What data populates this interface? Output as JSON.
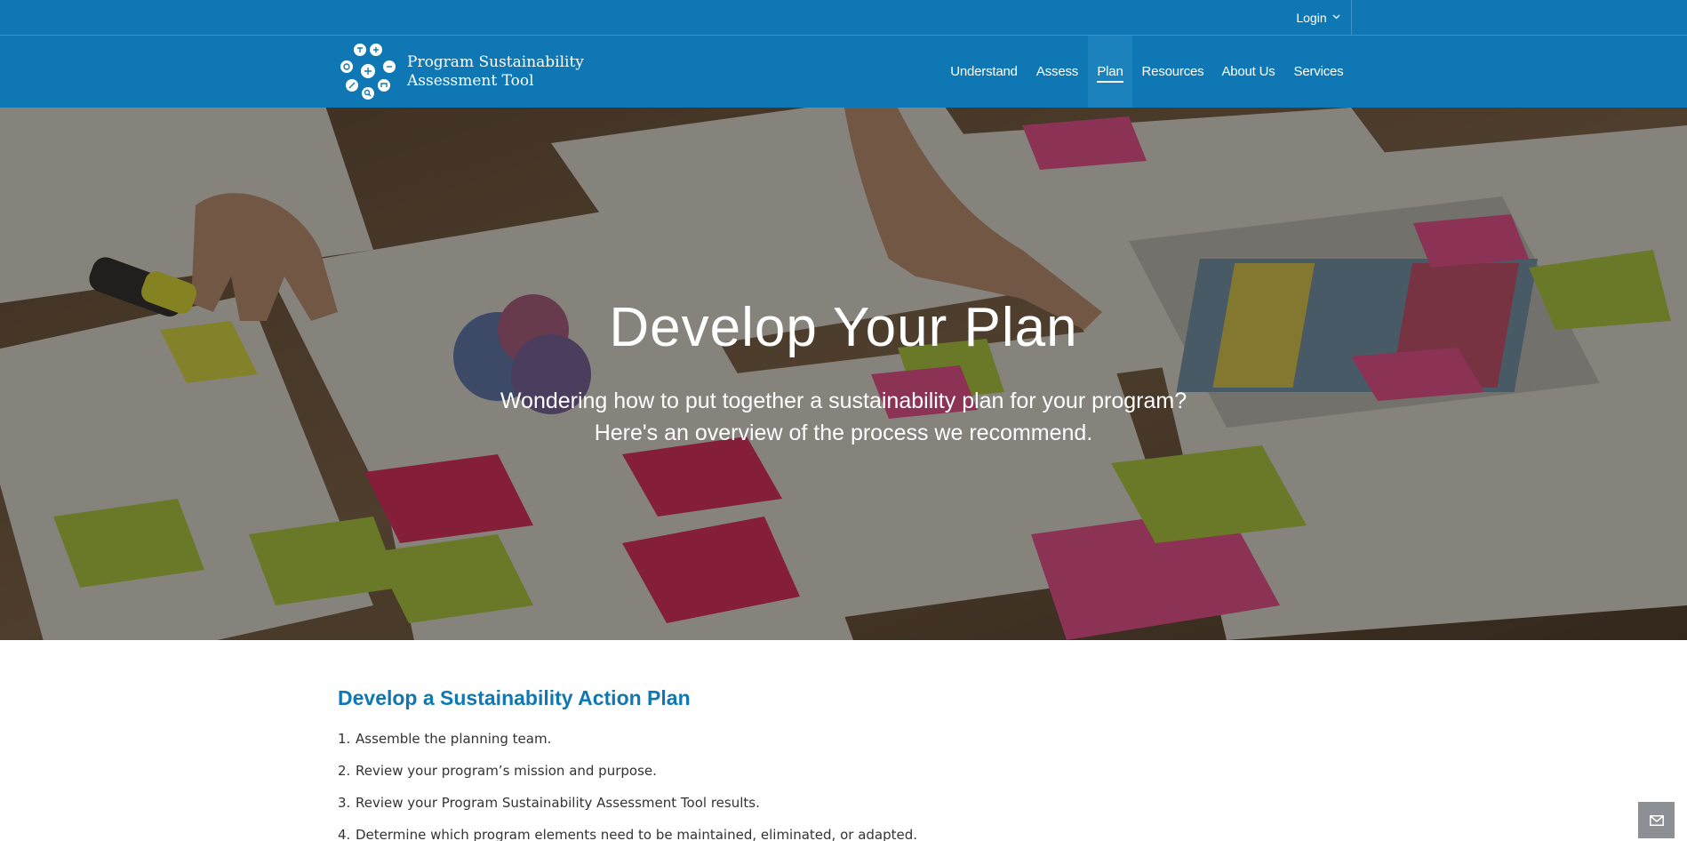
{
  "topbar": {
    "login_label": "Login",
    "login_caret": "⌄"
  },
  "brand": {
    "line1": "Program Sustainability",
    "line2": "Assessment Tool"
  },
  "nav": {
    "items": [
      {
        "label": "Understand",
        "active": false
      },
      {
        "label": "Assess",
        "active": false
      },
      {
        "label": "Plan",
        "active": true
      },
      {
        "label": "Resources",
        "active": false
      },
      {
        "label": "About Us",
        "active": false
      },
      {
        "label": "Services",
        "active": false
      }
    ]
  },
  "hero": {
    "title": "Develop Your Plan",
    "subtitle_line1": "Wondering how to put together a sustainability plan for your program?",
    "subtitle_line2": "Here's an overview of the process we recommend."
  },
  "section": {
    "title": "Develop a Sustainability Action Plan",
    "steps": [
      {
        "num": "1.",
        "text": "Assemble the planning team."
      },
      {
        "num": "2.",
        "text": "Review your program’s mission and purpose."
      },
      {
        "num": "3.",
        "text": "Review your Program Sustainability Assessment Tool results."
      },
      {
        "num": "4.",
        "text": "Determine which program elements need to be maintained, eliminated, or adapted."
      }
    ]
  },
  "colors": {
    "brand_blue": "#0f78b4",
    "title_blue": "#0f78b4",
    "text": "#333333"
  },
  "icons": {
    "logo": "sustainability-logo-icon",
    "feedback": "envelope-icon"
  }
}
